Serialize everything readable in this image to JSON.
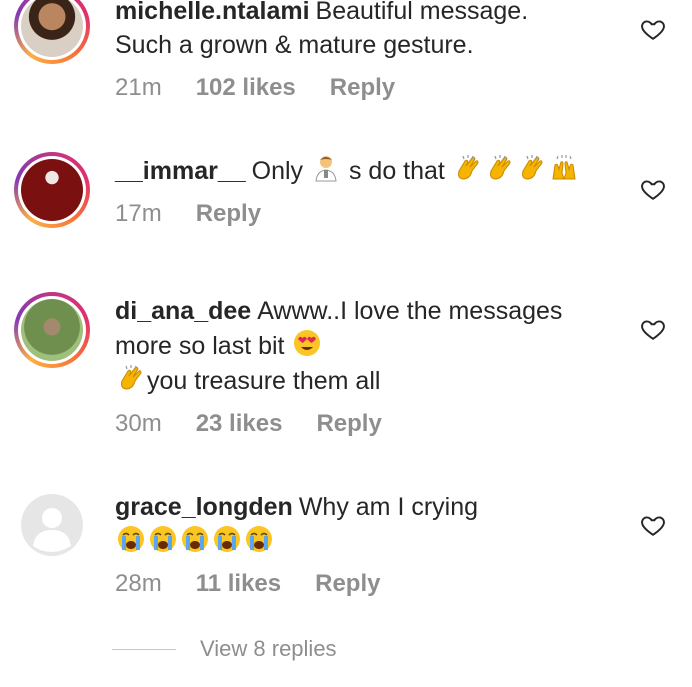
{
  "comments": [
    {
      "username": "michelle.ntalami",
      "text_line1": "Beautiful message.",
      "text_line2": "Such a grown & mature gesture.",
      "time": "21m",
      "likes": "102 likes",
      "reply": "Reply"
    },
    {
      "username": "__immar__",
      "text_a": "Only",
      "text_b": "s do that",
      "time": "17m",
      "reply": "Reply"
    },
    {
      "username": "di_ana_dee",
      "text_line1": "Awww..I love the messages",
      "text_line2": "more so last bit",
      "text_line3": "you treasure them all",
      "time": "30m",
      "likes": "23 likes",
      "reply": "Reply"
    },
    {
      "username": "grace_longden",
      "text_line1": "Why am I crying",
      "time": "28m",
      "likes": "11 likes",
      "reply": "Reply"
    }
  ],
  "view_replies": "View 8 replies",
  "colors": {
    "meta_gray": "#8e8e8e",
    "text": "#262626",
    "story_ring": "#e1306c"
  },
  "icons": [
    "heart-outline-icon",
    "clapping-hands-emoji",
    "man-emoji",
    "heart-eyes-emoji",
    "crying-face-emoji",
    "raising-hands-emoji"
  ]
}
